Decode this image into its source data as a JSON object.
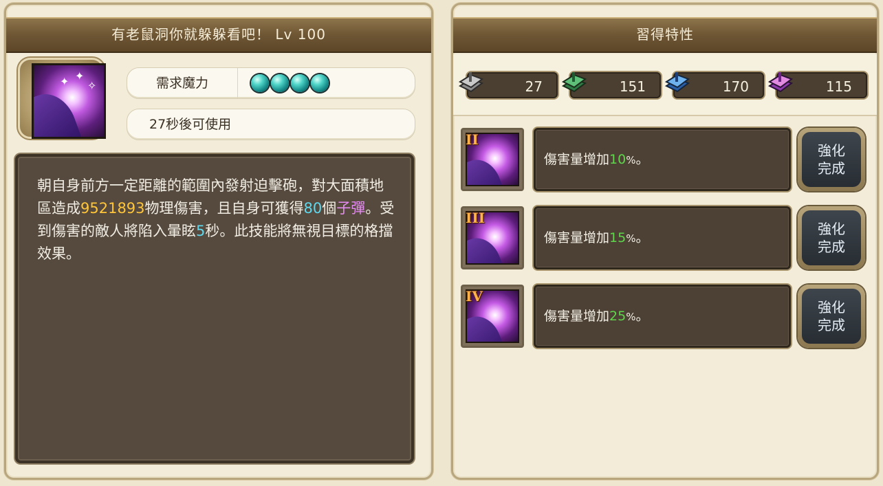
{
  "skill": {
    "title": "有老鼠洞你就躲躲看吧！ Lv 100",
    "mana_label": "需求魔力",
    "mana_orbs": 4,
    "cooldown": "27秒後可使用",
    "description": {
      "p1": "朝自身前方一定距離的範圍內發射迫擊砲，對大面積地區造成",
      "damage": "9521893",
      "p2": "物理傷害，且自身可獲得",
      "bullet_count": "80",
      "p3": "個",
      "bullet_name": "子彈",
      "p4": "。受到傷害的敵人將陷入暈眩",
      "stun_seconds": "5",
      "p5": "秒。此技能將無視目標的格擋效果。"
    }
  },
  "traits": {
    "title": "習得特性",
    "resources": [
      {
        "icon": "gray-book-icon",
        "value": "27",
        "color": "#8c8c8c"
      },
      {
        "icon": "green-book-icon",
        "value": "151",
        "color": "#3fa05a"
      },
      {
        "icon": "blue-book-icon",
        "value": "170",
        "color": "#3f86d8"
      },
      {
        "icon": "purple-book-icon",
        "value": "115",
        "color": "#b65ad8"
      }
    ],
    "items": [
      {
        "tier": "II",
        "text": "傷害量增加",
        "percent": "10",
        "suffix": "%",
        "end": "。",
        "button_line1": "強化",
        "button_line2": "完成"
      },
      {
        "tier": "III",
        "text": "傷害量增加",
        "percent": "15",
        "suffix": "%",
        "end": "。",
        "button_line1": "強化",
        "button_line2": "完成"
      },
      {
        "tier": "IV",
        "text": "傷害量增加",
        "percent": "25",
        "suffix": "%",
        "end": "。",
        "button_line1": "強化",
        "button_line2": "完成"
      }
    ]
  }
}
